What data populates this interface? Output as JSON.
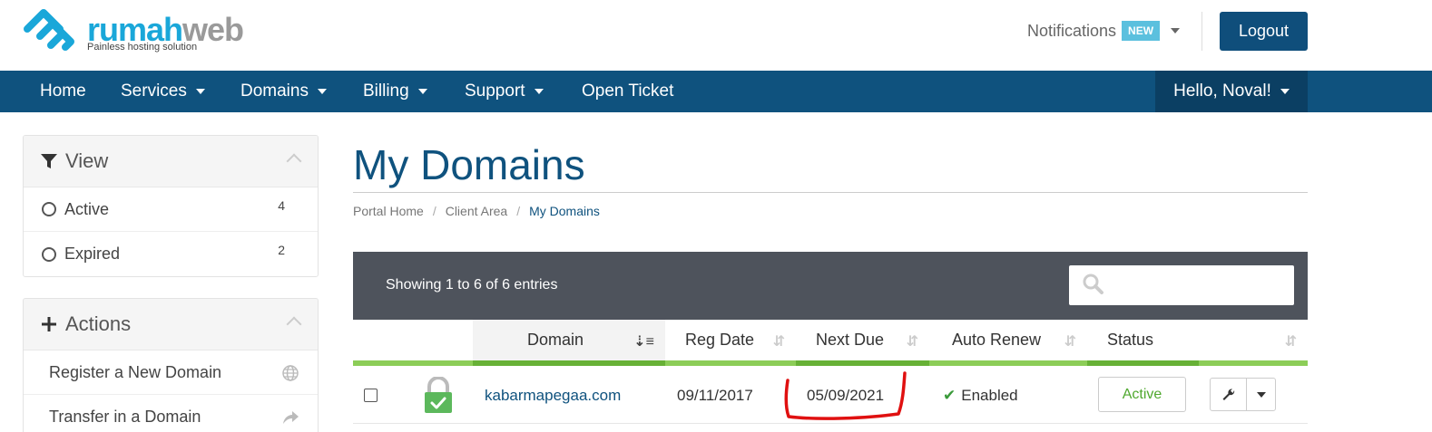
{
  "brand": {
    "name_part1": "rumah",
    "name_part2": "web",
    "tagline": "Painless hosting solution",
    "color_primary": "#1aa7d9",
    "color_secondary": "#9a9a9a"
  },
  "header": {
    "notifications_label": "Notifications",
    "notifications_badge": "NEW",
    "logout_label": "Logout"
  },
  "nav": {
    "items": [
      {
        "label": "Home",
        "dropdown": false
      },
      {
        "label": "Services",
        "dropdown": true
      },
      {
        "label": "Domains",
        "dropdown": true
      },
      {
        "label": "Billing",
        "dropdown": true
      },
      {
        "label": "Support",
        "dropdown": true
      },
      {
        "label": "Open Ticket",
        "dropdown": false
      }
    ],
    "user_greeting": "Hello, Noval!",
    "color": "#0f527e"
  },
  "sidebar": {
    "view": {
      "title": "View",
      "items": [
        {
          "label": "Active",
          "count": "4"
        },
        {
          "label": "Expired",
          "count": "2"
        }
      ]
    },
    "actions": {
      "title": "Actions",
      "items": [
        {
          "label": "Register a New Domain",
          "icon": "globe-icon"
        },
        {
          "label": "Transfer in a Domain",
          "icon": "share-arrow-icon"
        }
      ]
    }
  },
  "main": {
    "title": "My Domains",
    "breadcrumb": [
      "Portal Home",
      "Client Area",
      "My Domains"
    ],
    "table": {
      "showing_text": "Showing 1 to 6 of 6 entries",
      "search_placeholder": "",
      "columns": [
        "",
        "",
        "Domain",
        "Reg Date",
        "Next Due",
        "Auto Renew",
        "Status",
        ""
      ],
      "rows": [
        {
          "domain": "kabarmapegaa.com",
          "reg_date": "09/11/2017",
          "next_due": "05/09/2021",
          "auto_renew": "Enabled",
          "status": "Active",
          "ssl_icon": "lock-icon"
        }
      ]
    }
  },
  "colors": {
    "status_active": "#4fa82e",
    "table_header_bar": "#4e535c",
    "accent_green": "#8ccd58",
    "annotation_red": "#e01010"
  }
}
